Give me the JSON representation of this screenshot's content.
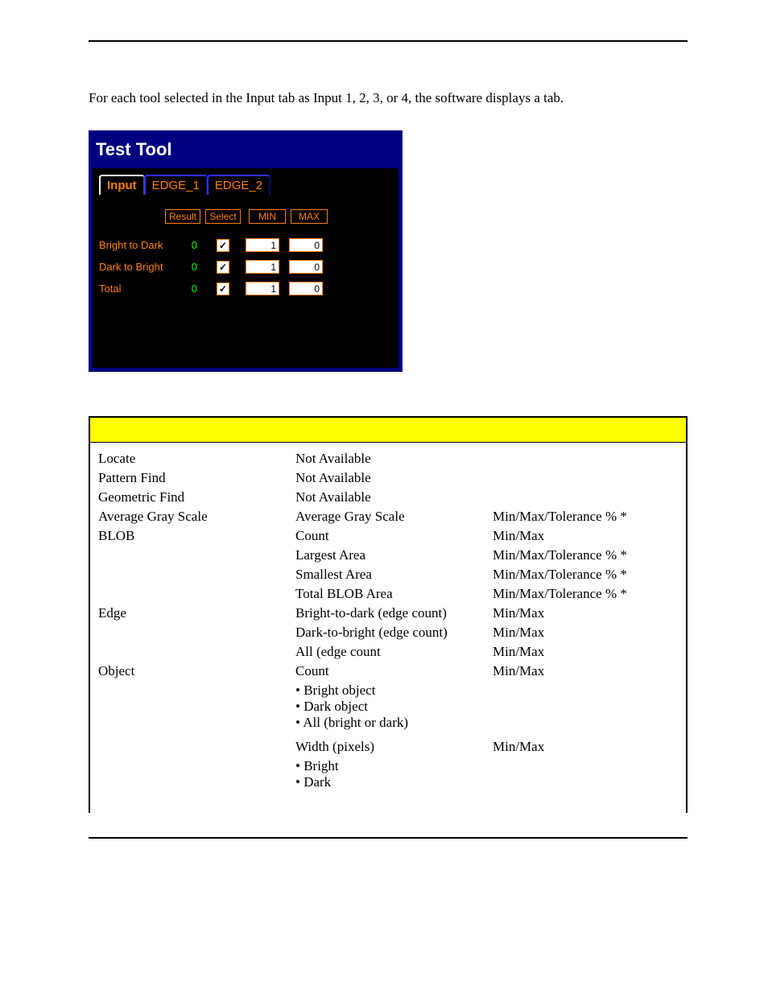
{
  "intro": "For each tool selected in the Input tab as Input 1, 2, 3, or 4, the software displays a tab.",
  "panel": {
    "title": "Test Tool",
    "tabs": {
      "input": "Input",
      "t1": "EDGE_1",
      "t2": "EDGE_2"
    },
    "headers": {
      "result": "Result",
      "select": "Select",
      "min": "MIN",
      "max": "MAX"
    },
    "rows": [
      {
        "label": "Bright to Dark",
        "result": "0",
        "checked": true,
        "min": "1",
        "max": "0"
      },
      {
        "label": "Dark to Bright",
        "result": "0",
        "checked": true,
        "min": "1",
        "max": "0"
      },
      {
        "label": "Total",
        "result": "0",
        "checked": true,
        "min": "1",
        "max": "0"
      }
    ]
  },
  "table": [
    {
      "c1": "Locate",
      "c2": "Not Available",
      "c3": ""
    },
    {
      "c1": "Pattern Find",
      "c2": "Not Available",
      "c3": ""
    },
    {
      "c1": "Geometric Find",
      "c2": "Not Available",
      "c3": ""
    },
    {
      "c1": "Average Gray Scale",
      "c2": "Average Gray Scale",
      "c3": "Min/Max/Tolerance % *"
    },
    {
      "c1": "BLOB",
      "c2": "Count",
      "c3": "Min/Max"
    },
    {
      "c1": "",
      "c2": "Largest Area",
      "c3": "Min/Max/Tolerance % *"
    },
    {
      "c1": "",
      "c2": "Smallest Area",
      "c3": "Min/Max/Tolerance % *"
    },
    {
      "c1": "",
      "c2": "Total BLOB Area",
      "c3": "Min/Max/Tolerance % *"
    },
    {
      "c1": "Edge",
      "c2": "Bright-to-dark (edge count)",
      "c3": "Min/Max"
    },
    {
      "c1": "",
      "c2": "Dark-to-bright (edge count)",
      "c3": "Min/Max"
    },
    {
      "c1": "",
      "c2": "All (edge count",
      "c3": "Min/Max"
    },
    {
      "c1": "Object",
      "c2": "Count",
      "c3": "Min/Max",
      "bullets": [
        "Bright object",
        "Dark object",
        "All (bright or dark)"
      ]
    },
    {
      "c1": "",
      "c2": "Width (pixels)",
      "c3": "Min/Max",
      "bullets": [
        "Bright",
        "Dark"
      ]
    }
  ]
}
